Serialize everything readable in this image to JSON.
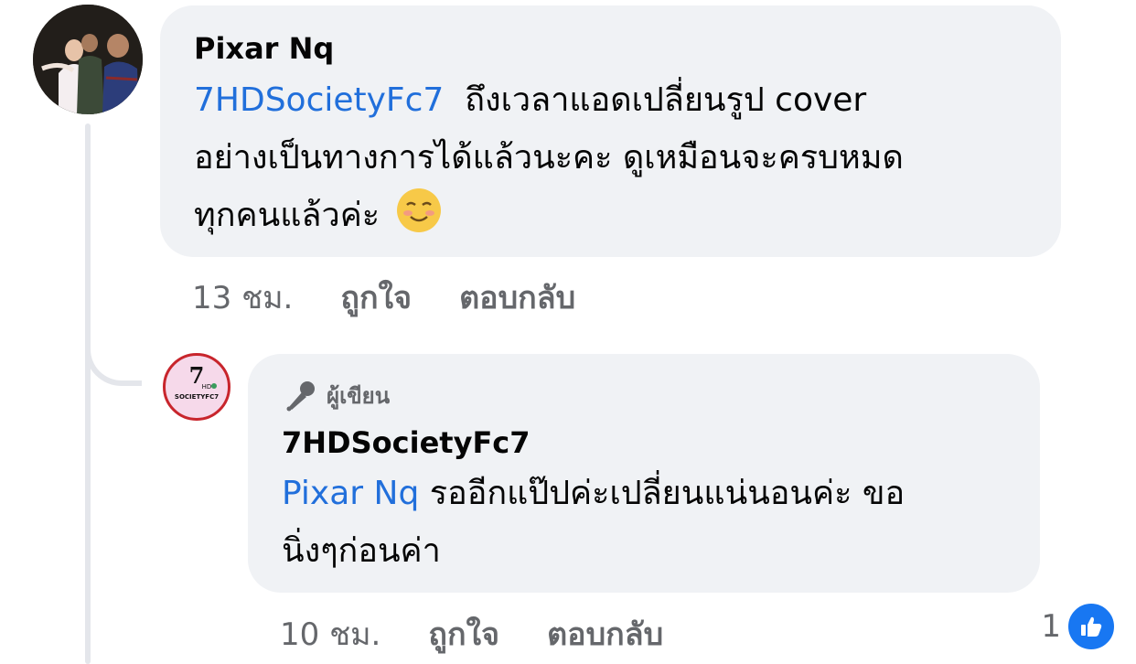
{
  "comment": {
    "author": "Pixar Nq",
    "mention": "7HDSocietyFc7",
    "lines": [
      "ถึงเวลาแอดเปลี่ยนรูป cover",
      "อย่างเป็นทางการได้แล้วนะคะ ดูเหมือนจะครบหมด",
      "ทุกคนแล้วค่ะ"
    ],
    "emoji": "smiling-face-icon",
    "time": "13 ชม.",
    "like_label": "ถูกใจ",
    "reply_label": "ตอบกลับ"
  },
  "reply": {
    "badge": "ผู้เขียน",
    "author": "7HDSocietyFc7",
    "mention": "Pixar Nq",
    "lines": [
      "รออีกแป๊ปค่ะเปลี่ยนแน่นอนค่ะ ขอ",
      "นิ่งๆก่อนค่า"
    ],
    "time": "10 ชม.",
    "like_label": "ถูกใจ",
    "reply_label": "ตอบกลับ",
    "reaction_count": "1",
    "avatar_logo": {
      "number": "7",
      "hd": "HD",
      "text": "SOCIETYFC7"
    }
  },
  "colors": {
    "bubble": "#f0f2f5",
    "mention": "#216fdb",
    "meta": "#65676b",
    "like": "#1877f2"
  }
}
